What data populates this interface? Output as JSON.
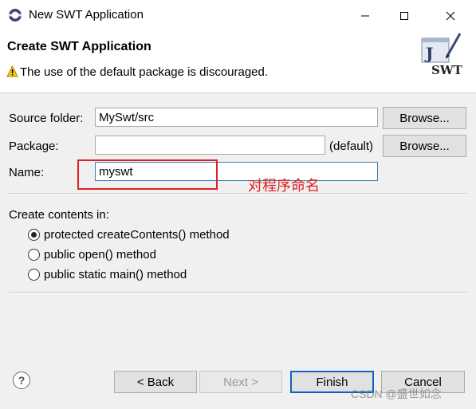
{
  "window": {
    "title": "New SWT Application"
  },
  "banner": {
    "title": "Create SWT Application",
    "message": "The use of the default package is discouraged.",
    "logo_text": "SWT",
    "logo_letter": "J"
  },
  "form": {
    "source_folder_label": "Source folder:",
    "source_folder_value": "MySwt/src",
    "package_label": "Package:",
    "package_value": "",
    "package_hint": "(default)",
    "name_label": "Name:",
    "name_value": "myswt",
    "browse_label": "Browse..."
  },
  "contents": {
    "label": "Create contents in:",
    "options": [
      {
        "label": "protected createContents() method",
        "selected": true
      },
      {
        "label": "public open() method",
        "selected": false
      },
      {
        "label": "public static main() method",
        "selected": false
      }
    ]
  },
  "annotation": {
    "text": "对程序命名",
    "color": "#e02020"
  },
  "footer": {
    "help_symbol": "?",
    "back_label": "< Back",
    "next_label": "Next >",
    "finish_label": "Finish",
    "cancel_label": "Cancel"
  },
  "watermark": "CSDN @盛世如念"
}
